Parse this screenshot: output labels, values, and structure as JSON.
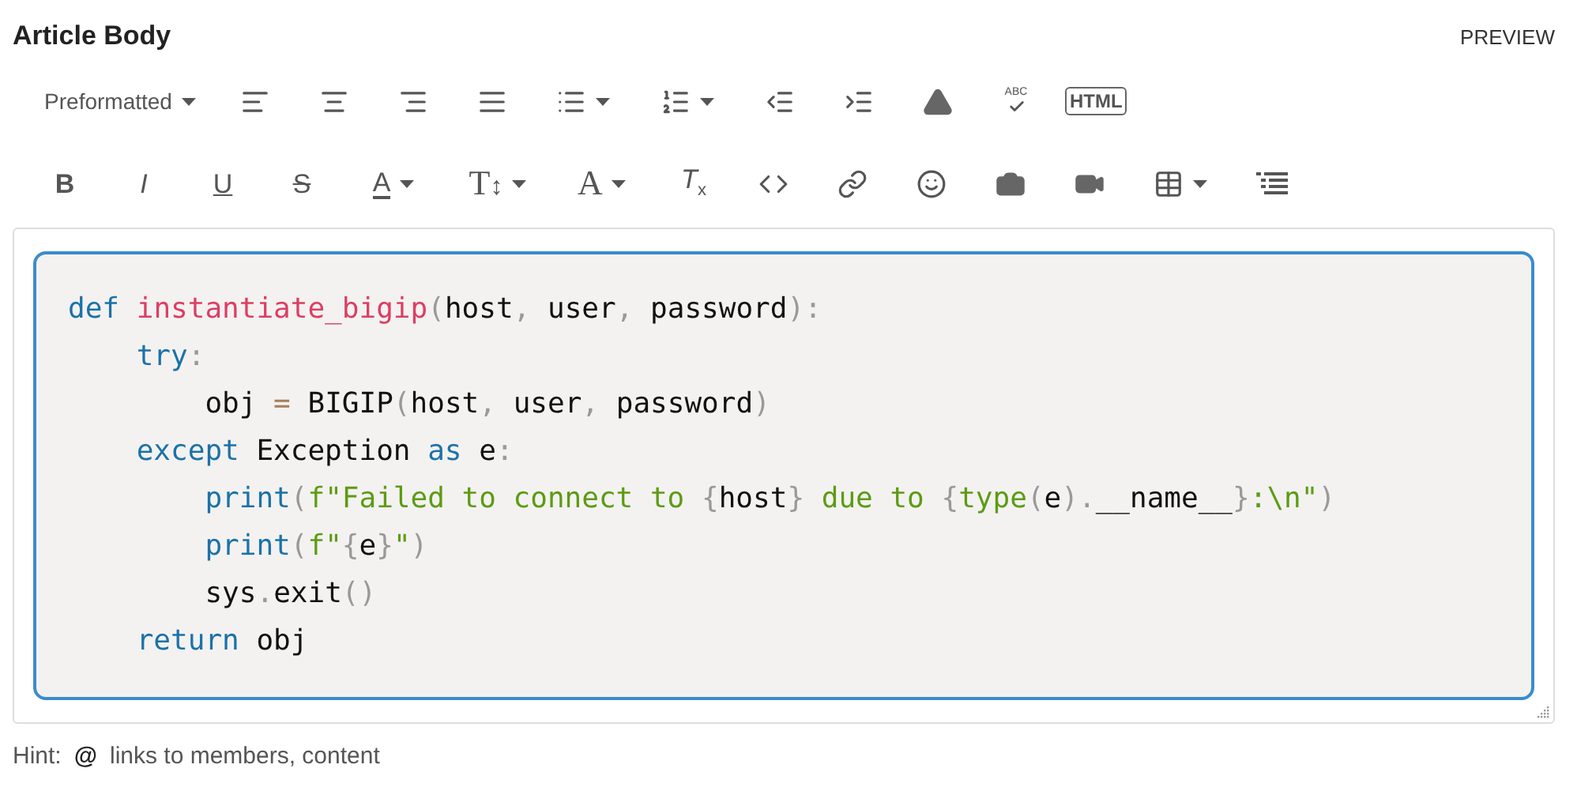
{
  "title": "Article Body",
  "preview": "PREVIEW",
  "toolbar_rows": [
    [
      {
        "kind": "format",
        "label": "Preformatted",
        "caret": true
      },
      {
        "kind": "align-left",
        "caret": false
      },
      {
        "kind": "align-center",
        "caret": false
      },
      {
        "kind": "align-right",
        "caret": false
      },
      {
        "kind": "align-justify",
        "caret": false
      },
      {
        "kind": "bullet-list",
        "caret": true
      },
      {
        "kind": "numbered-list",
        "caret": true
      },
      {
        "kind": "outdent",
        "caret": false
      },
      {
        "kind": "indent",
        "caret": false
      },
      {
        "kind": "warning",
        "caret": false
      },
      {
        "kind": "spellcheck",
        "label": "ABC",
        "caret": false
      },
      {
        "kind": "html",
        "label": "HTML",
        "caret": false
      }
    ],
    [
      {
        "kind": "bold",
        "label": "B",
        "caret": false
      },
      {
        "kind": "italic",
        "label": "I",
        "caret": false
      },
      {
        "kind": "underline",
        "label": "U",
        "caret": false
      },
      {
        "kind": "strike",
        "label": "S",
        "caret": false
      },
      {
        "kind": "color",
        "label": "A",
        "caret": true
      },
      {
        "kind": "size",
        "label": "T",
        "sub": "↕",
        "caret": true
      },
      {
        "kind": "font",
        "label": "A",
        "caret": true
      },
      {
        "kind": "clear",
        "label": "T",
        "sub": "x",
        "caret": false
      },
      {
        "kind": "code",
        "caret": false
      },
      {
        "kind": "link",
        "caret": false
      },
      {
        "kind": "emoji",
        "caret": false
      },
      {
        "kind": "camera",
        "caret": false
      },
      {
        "kind": "video",
        "caret": false
      },
      {
        "kind": "table",
        "caret": true
      },
      {
        "kind": "toc",
        "caret": false
      }
    ]
  ],
  "code_lines": [
    [
      {
        "text": "def",
        "color": "#1b72a8"
      },
      {
        "text": " instantiate_bigip",
        "color": "#dd3e63"
      },
      {
        "text": "(",
        "color": "#999999"
      },
      {
        "text": "host",
        "color": "#111111"
      },
      {
        "text": ", ",
        "color": "#999999"
      },
      {
        "text": "user",
        "color": "#111111"
      },
      {
        "text": ", ",
        "color": "#999999"
      },
      {
        "text": "password",
        "color": "#111111"
      },
      {
        "text": "):",
        "color": "#999999"
      }
    ],
    [
      {
        "text": "    try",
        "color": "#1b72a8"
      },
      {
        "text": ":",
        "color": "#999999"
      }
    ],
    [
      {
        "text": "        obj ",
        "color": "#111111"
      },
      {
        "text": "=",
        "color": "#a67f59"
      },
      {
        "text": " BIGIP",
        "color": "#111111"
      },
      {
        "text": "(",
        "color": "#999999"
      },
      {
        "text": "host",
        "color": "#111111"
      },
      {
        "text": ", ",
        "color": "#999999"
      },
      {
        "text": "user",
        "color": "#111111"
      },
      {
        "text": ", ",
        "color": "#999999"
      },
      {
        "text": "password",
        "color": "#111111"
      },
      {
        "text": ")",
        "color": "#999999"
      }
    ],
    [
      {
        "text": "    except",
        "color": "#1b72a8"
      },
      {
        "text": " Exception ",
        "color": "#111111"
      },
      {
        "text": "as",
        "color": "#1b72a8"
      },
      {
        "text": " e",
        "color": "#111111"
      },
      {
        "text": ":",
        "color": "#999999"
      }
    ],
    [
      {
        "text": "        print",
        "color": "#1b72a8"
      },
      {
        "text": "(",
        "color": "#999999"
      },
      {
        "text": "f\"Failed to connect to ",
        "color": "#5d9b12"
      },
      {
        "text": "{",
        "color": "#999999"
      },
      {
        "text": "host",
        "color": "#111111"
      },
      {
        "text": "}",
        "color": "#999999"
      },
      {
        "text": " due to ",
        "color": "#5d9b12"
      },
      {
        "text": "{",
        "color": "#999999"
      },
      {
        "text": "type",
        "color": "#5d9b12"
      },
      {
        "text": "(",
        "color": "#999999"
      },
      {
        "text": "e",
        "color": "#111111"
      },
      {
        "text": ").",
        "color": "#999999"
      },
      {
        "text": "__name__",
        "color": "#111111"
      },
      {
        "text": "}",
        "color": "#999999"
      },
      {
        "text": ":\\n\"",
        "color": "#5d9b12"
      },
      {
        "text": ")",
        "color": "#999999"
      }
    ],
    [
      {
        "text": "        print",
        "color": "#1b72a8"
      },
      {
        "text": "(",
        "color": "#999999"
      },
      {
        "text": "f\"",
        "color": "#5d9b12"
      },
      {
        "text": "{",
        "color": "#999999"
      },
      {
        "text": "e",
        "color": "#111111"
      },
      {
        "text": "}",
        "color": "#999999"
      },
      {
        "text": "\"",
        "color": "#5d9b12"
      },
      {
        "text": ")",
        "color": "#999999"
      }
    ],
    [
      {
        "text": "        sys",
        "color": "#111111"
      },
      {
        "text": ".",
        "color": "#999999"
      },
      {
        "text": "exit",
        "color": "#111111"
      },
      {
        "text": "()",
        "color": "#999999"
      }
    ],
    [
      {
        "text": "    return",
        "color": "#1b72a8"
      },
      {
        "text": " obj",
        "color": "#111111"
      }
    ]
  ],
  "hint": {
    "label": "Hint:",
    "at": "@",
    "text": "links to members, content"
  }
}
